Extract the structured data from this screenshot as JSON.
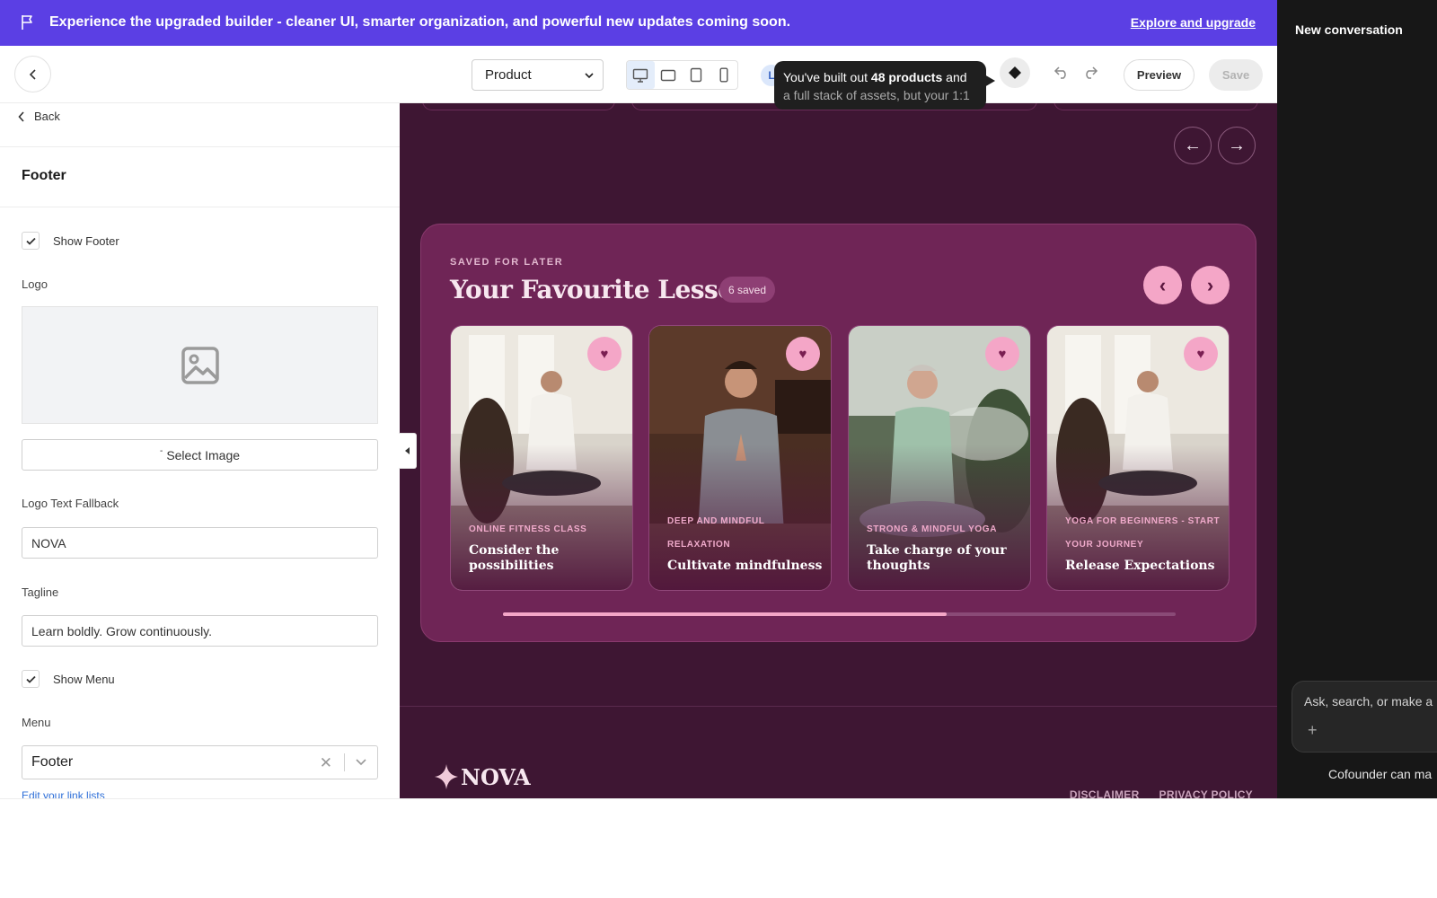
{
  "banner": {
    "message": "Experience the upgraded builder - cleaner UI, smarter organization, and powerful new updates coming soon.",
    "cta": "Explore and upgrade",
    "bg_color": "#5b3fe4"
  },
  "toolbar": {
    "page_select_value": "Product",
    "lang_initial": "L",
    "tooltip_line1_pre": "You've built out ",
    "tooltip_line1_bold": "48 products",
    "tooltip_line1_post": " and",
    "tooltip_line2": "a full stack of assets, but your 1:1",
    "preview_label": "Preview",
    "save_label": "Save",
    "devices": [
      "desktop-icon",
      "tablet-landscape-icon",
      "tablet-portrait-icon",
      "mobile-icon"
    ],
    "active_device": "desktop"
  },
  "ai_panel": {
    "title": "New conversation",
    "chat_placeholder": "Ask, search, or make a",
    "footnote": "Cofounder can ma"
  },
  "settings": {
    "back_label": "Back",
    "section_title": "Footer",
    "show_footer_label": "Show Footer",
    "show_footer_checked": true,
    "logo_label": "Logo",
    "select_image_label": "Select Image",
    "logo_text_fallback_label": "Logo Text Fallback",
    "logo_text_fallback_value": "NOVA",
    "tagline_label": "Tagline",
    "tagline_value": "Learn boldly. Grow continuously.",
    "show_menu_label": "Show Menu",
    "show_menu_checked": true,
    "menu_label": "Menu",
    "menu_value": "Footer",
    "edit_link": "Edit your link lists"
  },
  "canvas": {
    "favourites": {
      "kicker": "SAVED FOR LATER",
      "heading": "Your Favourite Lessons",
      "badge": "6 saved",
      "scroll_progress": 0.66,
      "lessons": [
        {
          "category": "ONLINE FITNESS CLASS",
          "title": "Consider the possibilities"
        },
        {
          "category": "DEEP AND MINDFUL RELAXATION",
          "title": "Cultivate mindfulness"
        },
        {
          "category": "STRONG & MINDFUL YOGA",
          "title": "Take charge of your thoughts"
        },
        {
          "category": "YOGA FOR BEGINNERS - START YOUR JOURNEY",
          "title": "Release Expectations"
        }
      ]
    },
    "footer": {
      "logo_text": "NOVA",
      "links": [
        "DISCLAIMER",
        "PRIVACY POLICY"
      ]
    },
    "colors": {
      "page_bg": "#3e1633",
      "card_bg": "#6f2556",
      "accent_pink": "#f4a6c7"
    }
  }
}
